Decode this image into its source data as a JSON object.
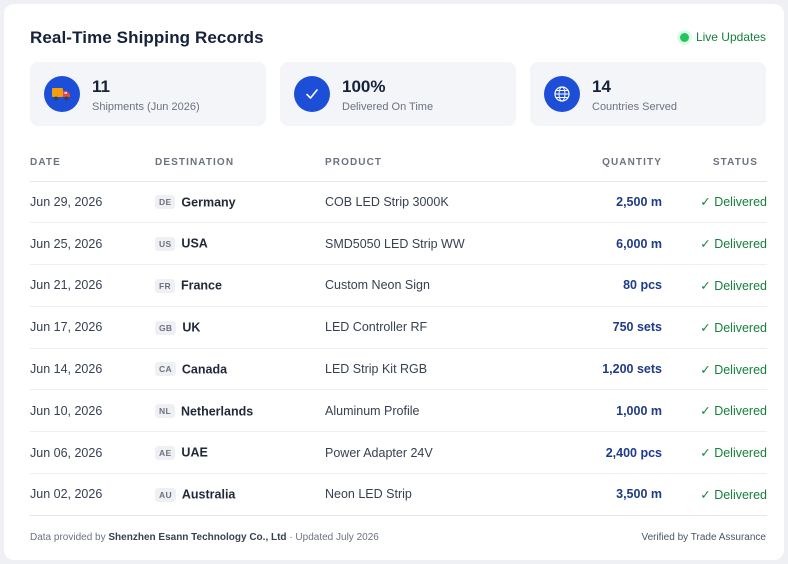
{
  "header": {
    "title": "Real-Time Shipping Records",
    "live_label": "Live Updates",
    "live_color": "#22c55e"
  },
  "stats": [
    {
      "icon": "truck-icon",
      "value": "11",
      "label": "Shipments (Jun 2026)"
    },
    {
      "icon": "check-icon",
      "value": "100%",
      "label": "Delivered On Time"
    },
    {
      "icon": "globe-icon",
      "value": "14",
      "label": "Countries Served"
    }
  ],
  "table": {
    "columns": [
      "DATE",
      "DESTINATION",
      "PRODUCT",
      "QUANTITY",
      "STATUS"
    ],
    "rows": [
      {
        "date": "Jun 29, 2026",
        "code": "DE",
        "country": "Germany",
        "product": "COB LED Strip 3000K",
        "quantity": "2,500 m",
        "status": "✓ Delivered"
      },
      {
        "date": "Jun 25, 2026",
        "code": "US",
        "country": "USA",
        "product": "SMD5050 LED Strip WW",
        "quantity": "6,000 m",
        "status": "✓ Delivered"
      },
      {
        "date": "Jun 21, 2026",
        "code": "FR",
        "country": "France",
        "product": "Custom Neon Sign",
        "quantity": "80 pcs",
        "status": "✓ Delivered"
      },
      {
        "date": "Jun 17, 2026",
        "code": "GB",
        "country": "UK",
        "product": "LED Controller RF",
        "quantity": "750 sets",
        "status": "✓ Delivered"
      },
      {
        "date": "Jun 14, 2026",
        "code": "CA",
        "country": "Canada",
        "product": "LED Strip Kit RGB",
        "quantity": "1,200 sets",
        "status": "✓ Delivered"
      },
      {
        "date": "Jun 10, 2026",
        "code": "NL",
        "country": "Netherlands",
        "product": "Aluminum Profile",
        "quantity": "1,000 m",
        "status": "✓ Delivered"
      },
      {
        "date": "Jun 06, 2026",
        "code": "AE",
        "country": "UAE",
        "product": "Power Adapter 24V",
        "quantity": "2,400 pcs",
        "status": "✓ Delivered"
      },
      {
        "date": "Jun 02, 2026",
        "code": "AU",
        "country": "Australia",
        "product": "Neon LED Strip",
        "quantity": "3,500 m",
        "status": "✓ Delivered"
      }
    ]
  },
  "footer": {
    "prefix": "Data provided by",
    "company": "Shenzhen Esann Technology Co., Ltd",
    "updated": "· Updated July 2026",
    "verified_prefix": "Verified by",
    "verified_by": "Trade Assurance"
  },
  "colors": {
    "accent": "#1d4ed8",
    "quantity": "#1e3a8a",
    "delivered": "#15803d"
  }
}
